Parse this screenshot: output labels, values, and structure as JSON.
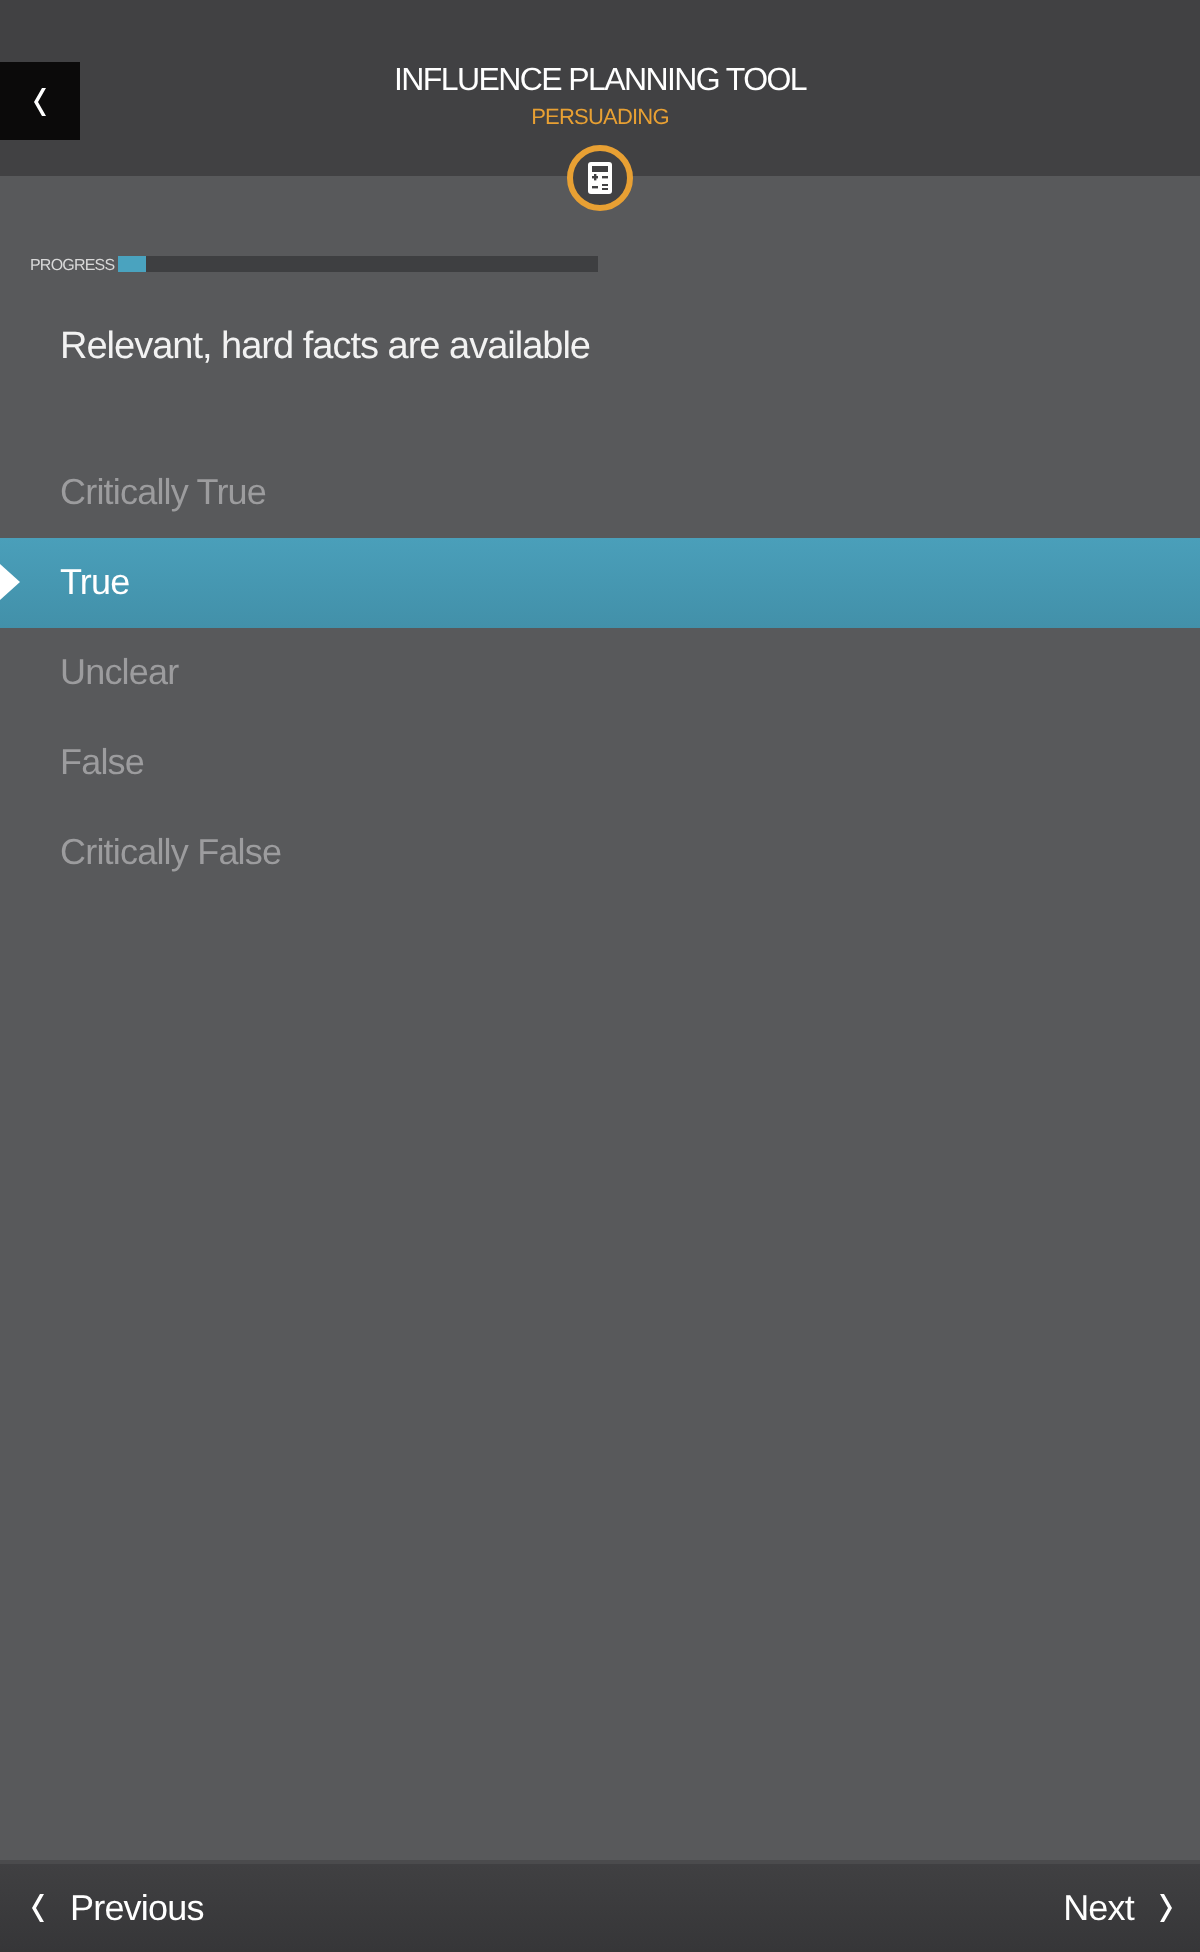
{
  "header": {
    "title": "INFLUENCE PLANNING TOOL",
    "subtitle": "PERSUADING"
  },
  "progress": {
    "label": "PROGRESS",
    "level": 0.06
  },
  "question": "Relevant, hard facts are available",
  "options": [
    {
      "label": "Critically True",
      "selected": false
    },
    {
      "label": "True",
      "selected": true
    },
    {
      "label": "Unclear",
      "selected": false
    },
    {
      "label": "False",
      "selected": false
    },
    {
      "label": "Critically False",
      "selected": false
    }
  ],
  "footer": {
    "previous": "Previous",
    "next": "Next"
  }
}
